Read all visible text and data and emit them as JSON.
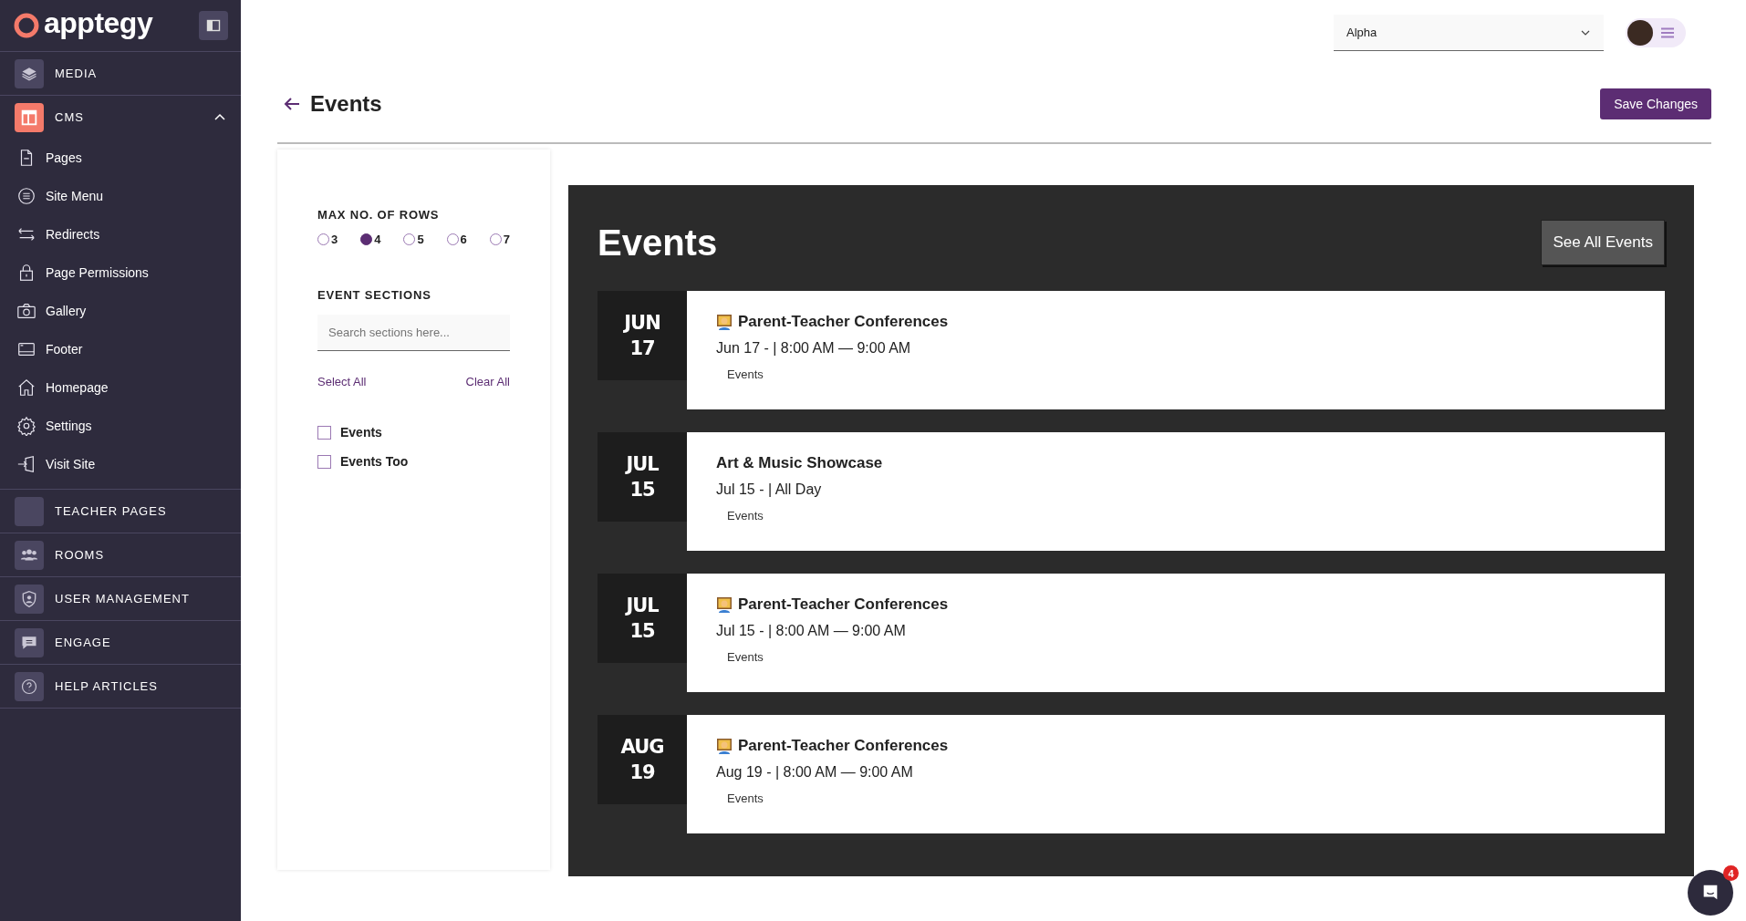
{
  "sidebar": {
    "logo": "apptegy",
    "sections": [
      {
        "label": "MEDIA"
      },
      {
        "label": "CMS",
        "expanded": true,
        "children": [
          {
            "label": "Pages"
          },
          {
            "label": "Site Menu"
          },
          {
            "label": "Redirects"
          },
          {
            "label": "Page Permissions"
          },
          {
            "label": "Gallery"
          },
          {
            "label": "Footer"
          },
          {
            "label": "Homepage"
          },
          {
            "label": "Settings"
          },
          {
            "label": "Visit Site"
          }
        ]
      },
      {
        "label": "TEACHER PAGES"
      },
      {
        "label": "ROOMS"
      },
      {
        "label": "USER MANAGEMENT"
      },
      {
        "label": "ENGAGE"
      },
      {
        "label": "HELP ARTICLES"
      }
    ]
  },
  "header": {
    "site_select": "Alpha"
  },
  "page": {
    "title": "Events",
    "save_button": "Save Changes"
  },
  "settings": {
    "rows_label": "MAX NO. OF ROWS",
    "rows_options": [
      {
        "label": "3",
        "selected": false
      },
      {
        "label": "4",
        "selected": true
      },
      {
        "label": "5",
        "selected": false
      },
      {
        "label": "6",
        "selected": false
      },
      {
        "label": "7",
        "selected": false
      }
    ],
    "sections_label": "EVENT SECTIONS",
    "search": {
      "placeholder": "Search sections here..."
    },
    "select_all": "Select All",
    "clear_all": "Clear All",
    "sections": [
      {
        "label": "Events",
        "checked": false
      },
      {
        "label": "Events Too",
        "checked": false
      }
    ]
  },
  "preview": {
    "title": "Events",
    "see_all": "See All Events",
    "events": [
      {
        "month": "JUN",
        "day": "17",
        "title": "Parent-Teacher Conferences",
        "has_icon": true,
        "when": "Jun 17 - | 8:00 AM — 9:00 AM",
        "section": "Events"
      },
      {
        "month": "JUL",
        "day": "15",
        "title": "Art & Music Showcase",
        "has_icon": false,
        "when": "Jul 15 - | All Day",
        "section": "Events"
      },
      {
        "month": "JUL",
        "day": "15",
        "title": "Parent-Teacher Conferences",
        "has_icon": true,
        "when": "Jul 15 - | 8:00 AM — 9:00 AM",
        "section": "Events"
      },
      {
        "month": "AUG",
        "day": "19",
        "title": "Parent-Teacher Conferences",
        "has_icon": true,
        "when": "Aug 19 - | 8:00 AM — 9:00 AM",
        "section": "Events"
      }
    ]
  },
  "chat": {
    "badge": "4"
  }
}
